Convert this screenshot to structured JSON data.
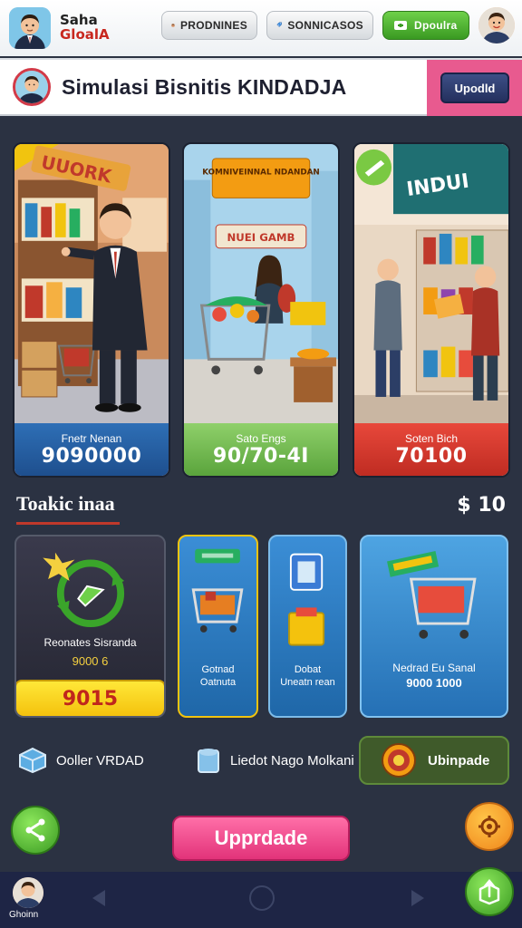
{
  "topbar": {
    "brand_line1": "Saha",
    "brand_line2": "GloalA",
    "pill1_label": "PRODNINES",
    "pill2_label": "SONNICASOS",
    "pill3_label": "Dpoulra"
  },
  "banner": {
    "title": "Simulasi Bisnitis KINDADJA",
    "update_label": "Upodld"
  },
  "scenes": [
    {
      "sign": "UUORK",
      "label": "Fnetr Nenan",
      "value": "9090000"
    },
    {
      "sign": "KOMNIVEINNAL NDANDAN",
      "sub_sign": "NUEI GAMB",
      "label": "Sato Engs",
      "value": "90/70-4I"
    },
    {
      "sign": "INDUI",
      "label": "Soten Bich",
      "value": "70100"
    }
  ],
  "section": {
    "title": "Toakic inaa",
    "amount": "$ 10"
  },
  "items": [
    {
      "name": "Reonates Sisranda",
      "value": "9000 6",
      "button": "9015"
    },
    {
      "name": "Gotnad Oatnuta"
    },
    {
      "name": "Dobat Uneatn rean"
    },
    {
      "name": "Nedrad Eu Sanal",
      "value": "9000 1000"
    }
  ],
  "actions": {
    "action1": "Ooller VRDAD",
    "action2": "Liedot Nago Molkani",
    "action3": "Ubinpade",
    "upgrade_button": "Upprdade"
  },
  "navbar": {
    "profile_label": "Ghoinn"
  },
  "colors": {
    "background": "#2b3242",
    "accent_pink": "#e2337a",
    "accent_green": "#3a9a22",
    "accent_yellow": "#f4c20d",
    "accent_red": "#c0392b",
    "navbar": "#1e2545"
  },
  "icons": {
    "pill1": "person-face-icon",
    "pill2": "tag-icon",
    "pill3": "ticket-icon",
    "fab_left": "share-icon",
    "fab_right": "gear-icon",
    "fab_nav": "box-upload-icon"
  }
}
